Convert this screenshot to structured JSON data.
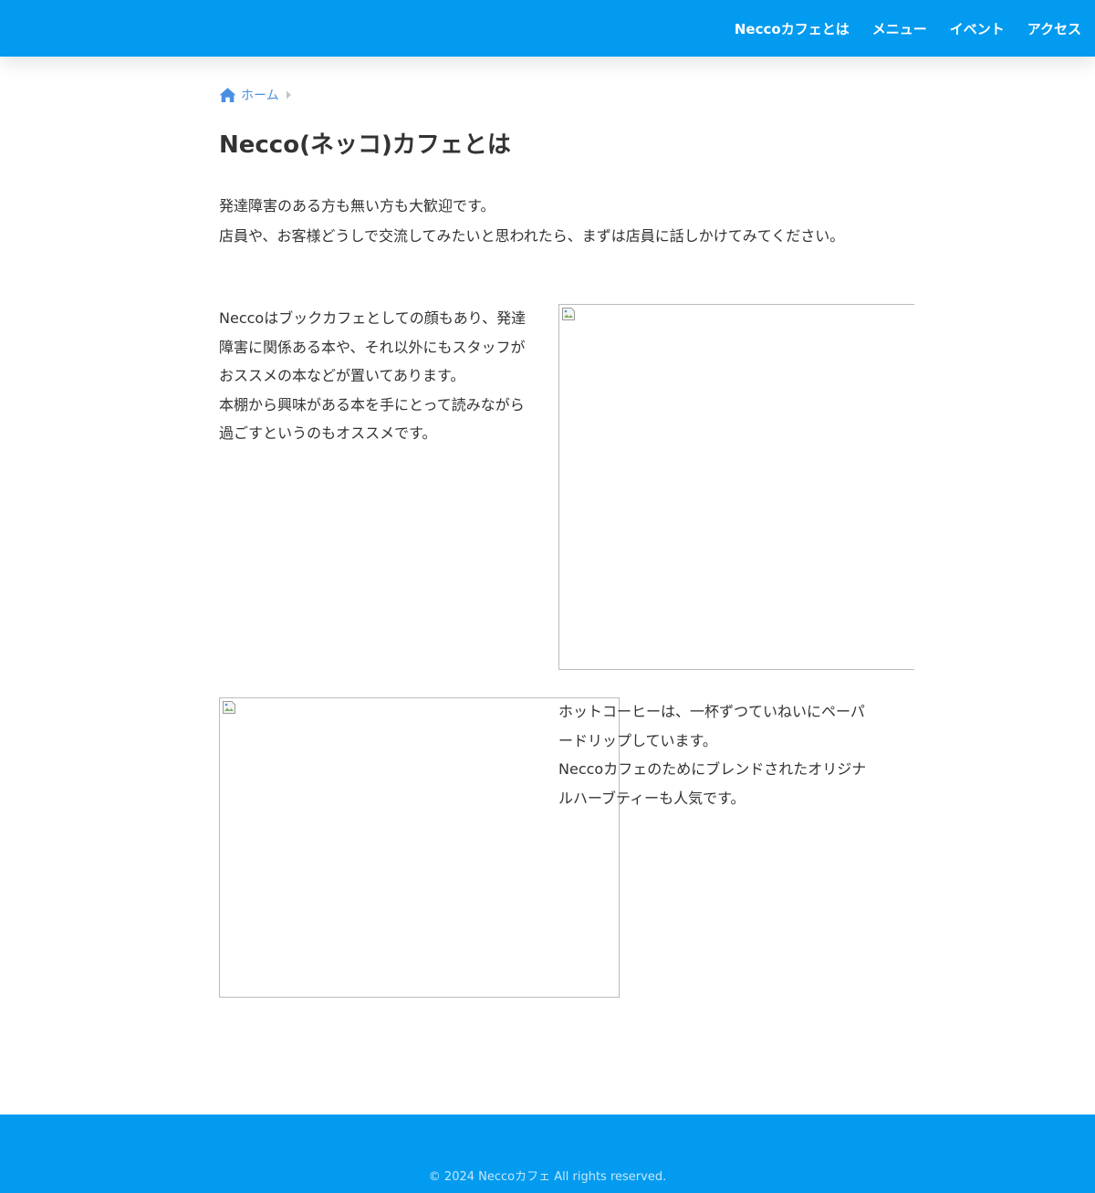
{
  "header": {
    "nav": [
      {
        "label": "Neccoカフェとは"
      },
      {
        "label": "メニュー"
      },
      {
        "label": "イベント"
      },
      {
        "label": "アクセス"
      }
    ],
    "background_color": "#039bef"
  },
  "breadcrumb": {
    "icon": "home-icon",
    "home_label": "ホーム",
    "separator_icon": "chevron-right-icon"
  },
  "page_title": "Necco(ネッコ)カフェとは",
  "intro": {
    "line1": "発達障害のある方も無い方も大歓迎です。",
    "line2": "店員や、お客様どうしで交流してみたいと思われたら、まずは店員に話しかけてみてください。"
  },
  "section1": {
    "paragraph1": "Neccoはブックカフェとしての顔もあり、発達障害に関係ある本や、それ以外にもスタッフがおススメの本などが置いてあります。",
    "paragraph2": "本棚から興味がある本を手にとって読みながら過ごすというのもオススメです。",
    "image_icon": "broken-image-icon"
  },
  "section2": {
    "paragraph1": "ホットコーヒーは、一杯ずつていねいにペーパードリップしています。",
    "paragraph2": "Neccoカフェのためにブレンドされたオリジナルハーブティーも人気です。",
    "image_icon": "broken-image-icon"
  },
  "footer": {
    "copyright": "© 2024 Neccoカフェ All rights reserved.",
    "background_color": "#039bef"
  }
}
